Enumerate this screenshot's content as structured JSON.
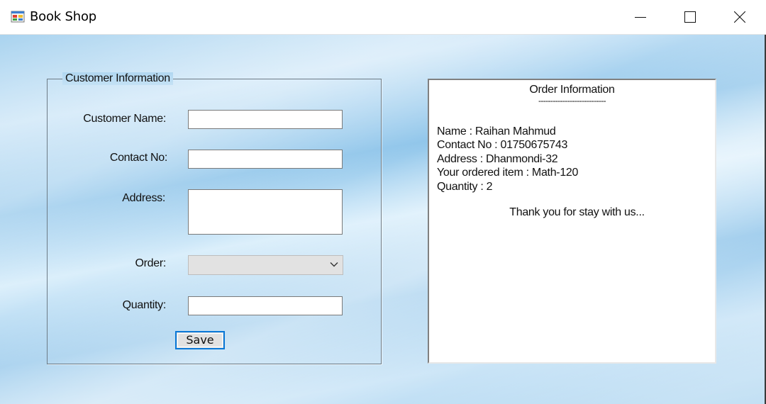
{
  "window": {
    "title": "Book Shop",
    "icons": {
      "app": "app-form-icon",
      "minimize": "minimize-icon",
      "maximize": "maximize-icon",
      "close": "close-icon"
    }
  },
  "customer_info": {
    "legend": "Customer Information",
    "name_label": "Customer Name:",
    "contact_label": "Contact No:",
    "address_label": "Address:",
    "order_label": "Order:",
    "quantity_label": "Quantity:",
    "name_value": "",
    "contact_value": "",
    "address_value": "",
    "order_selected": "",
    "quantity_value": "",
    "save_label": "Save"
  },
  "order_info": {
    "title": "Order Information",
    "divider": "----------------------------",
    "lines": [
      "Name : Raihan Mahmud",
      "Contact No : 01750675743",
      "Address : Dhanmondi-32",
      "Your ordered item : Math-120",
      "Quantity : 2"
    ],
    "thanks": "Thank you for stay with us..."
  },
  "colors": {
    "focus_border": "#0a78d7",
    "background": "#a9d3ef"
  }
}
